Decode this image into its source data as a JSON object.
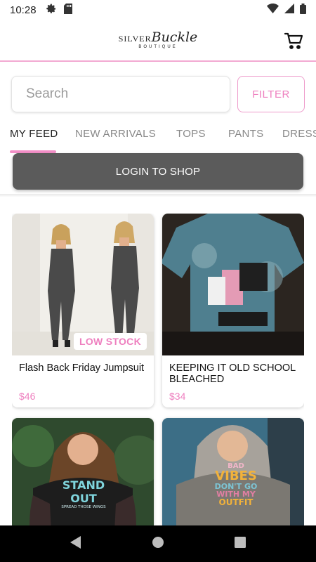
{
  "status_bar": {
    "time": "10:28"
  },
  "header": {
    "logo_line1_a": "SILVER",
    "logo_line1_b": "Buckle",
    "logo_line2": "BOUTIQUE"
  },
  "search": {
    "placeholder": "Search",
    "value": ""
  },
  "filter_label": "FILTER",
  "tabs": [
    {
      "label": "MY FEED",
      "active": true
    },
    {
      "label": "NEW ARRIVALS",
      "active": false
    },
    {
      "label": "TOPS",
      "active": false
    },
    {
      "label": "PANTS",
      "active": false
    },
    {
      "label": "DRESSES",
      "active": false
    }
  ],
  "login_label": "LOGIN TO SHOP",
  "products": [
    {
      "name": "Flash Back Friday Jumpsuit",
      "price": "$46",
      "badge": "LOW STOCK"
    },
    {
      "name": "KEEPING IT OLD SCHOOL BLEACHED",
      "price": "$34",
      "badge": ""
    },
    {
      "name": "",
      "price": "",
      "badge": "",
      "shirt_text": [
        "STAND OUT",
        "SPREAD THOSE WINGS"
      ]
    },
    {
      "name": "",
      "price": "",
      "badge": "",
      "shirt_text": [
        "BAD",
        "VIBES",
        "DON'T GO",
        "WITH MY",
        "OUTFIT"
      ]
    }
  ],
  "colors": {
    "accent_pink": "#ee7fbf",
    "login_bg": "#5b5b5b",
    "divider_pink": "#f2a9d2"
  }
}
